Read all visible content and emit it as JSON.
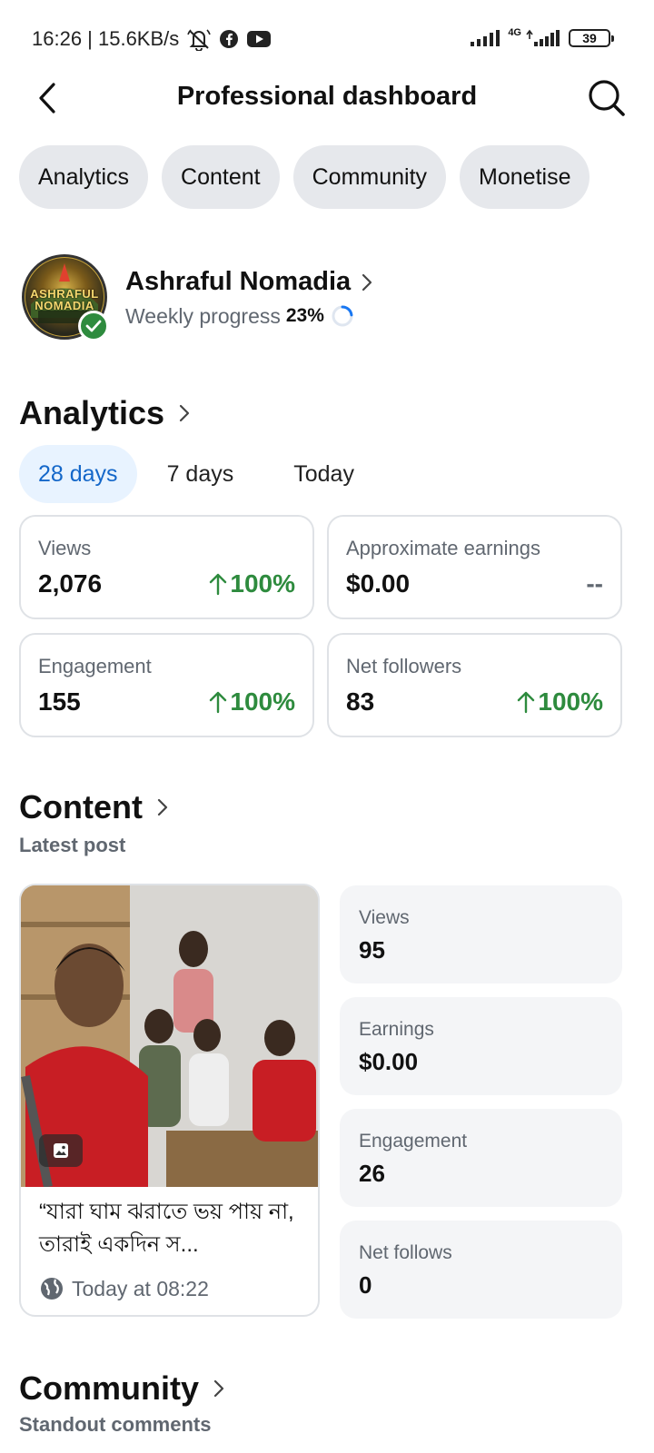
{
  "status_bar": {
    "time_speed": "16:26 | 15.6KB/s",
    "network": "4G",
    "battery": "39"
  },
  "header": {
    "title": "Professional dashboard"
  },
  "chips": [
    "Analytics",
    "Content",
    "Community",
    "Monetise"
  ],
  "profile": {
    "name": "Ashraful Nomadia",
    "avatar_text": "ASHRAFUL NOMADIA",
    "progress_label": "Weekly progress",
    "progress_value": "23%",
    "progress_fraction": 0.23
  },
  "analytics": {
    "title": "Analytics",
    "ranges": [
      "28 days",
      "7 days",
      "Today"
    ],
    "active_range": "28 days",
    "stats": [
      {
        "label": "Views",
        "value": "2,076",
        "change": "100%",
        "trend": "up"
      },
      {
        "label": "Approximate earnings",
        "value": "$0.00",
        "change": "--",
        "trend": "none"
      },
      {
        "label": "Engagement",
        "value": "155",
        "change": "100%",
        "trend": "up"
      },
      {
        "label": "Net followers",
        "value": "83",
        "change": "100%",
        "trend": "up"
      }
    ]
  },
  "content": {
    "title": "Content",
    "subtitle": "Latest post",
    "post": {
      "caption": "“যারা ঘাম ঝরাতে ভয় পায় না, তারাই একদিন স...",
      "time": "Today at 08:22"
    },
    "post_stats": [
      {
        "label": "Views",
        "value": "95"
      },
      {
        "label": "Earnings",
        "value": "$0.00"
      },
      {
        "label": "Engagement",
        "value": "26"
      },
      {
        "label": "Net follows",
        "value": "0"
      }
    ]
  },
  "community": {
    "title": "Community",
    "subtitle": "Standout comments"
  },
  "colors": {
    "accent_blue": "#1467c9",
    "active_tab_bg": "#e8f3ff",
    "positive_green": "#2e8b3e",
    "chip_bg": "#e6e8ec",
    "card_border": "#dfe2e6",
    "muted_text": "#606770"
  }
}
